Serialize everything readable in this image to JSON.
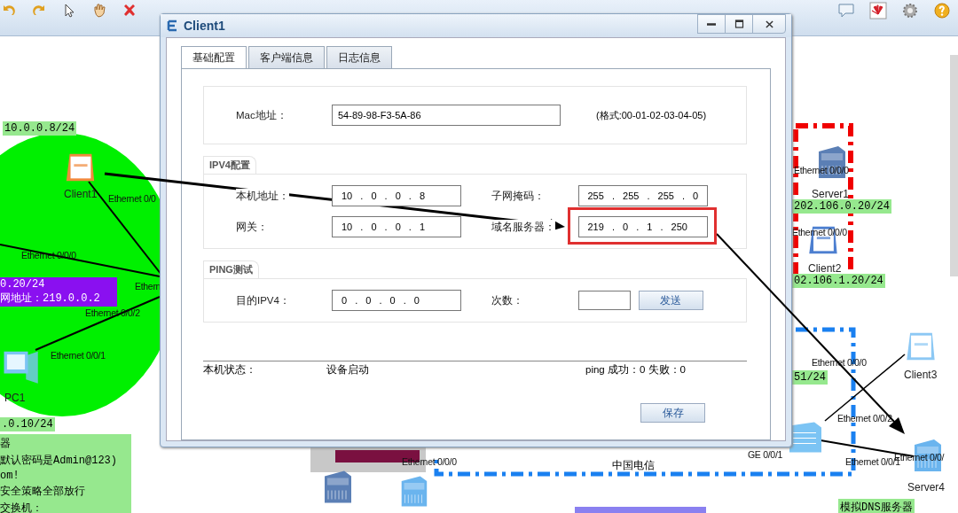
{
  "topology": {
    "devices": [
      {
        "kind": "client",
        "name": "Client1",
        "color": "#f08a3c"
      },
      {
        "kind": "pc",
        "name": "PC1",
        "color": "#7cc4f4"
      },
      {
        "kind": "server",
        "name": "Server1",
        "color": "#5b7fb5"
      },
      {
        "kind": "client",
        "name": "Client2",
        "color": "#4d7fd0"
      },
      {
        "kind": "client",
        "name": "Client3",
        "color": "#8cc8f4"
      },
      {
        "kind": "switch",
        "color": "#7cc4f4"
      },
      {
        "kind": "server",
        "name": "Server4",
        "color": "#6ab4ee"
      },
      {
        "kind": "server",
        "color": "#5b7fb5"
      },
      {
        "kind": "server",
        "color": "#6ab4ee"
      }
    ],
    "port_labels": [
      "Ethernet 0/0",
      "Ethernet 0/0/0",
      "Ethernet 0/0/2",
      "Ethern",
      "Ethernet 0/0/1",
      "Ethernet 0/0/0",
      "Ethernet 0/0/0",
      "Ethernet 0/0/0",
      "Ethernet 0/0/2",
      "GE 0/0/1",
      "Ethernet 0/0/1",
      "Ethernet 0/0/",
      "Ethernet 0/0/0"
    ],
    "address_labels": [
      "10.0.0.8/24",
      ".0.10/24",
      "202.106.0.20/24",
      "02.106.1.20/24",
      "51/24",
      "模拟DNS服务器"
    ],
    "nat_note": [
      "0.20/24",
      "网地址：219.0.0.2"
    ],
    "notes": [
      "器",
      "默认密码是Admin@123)",
      "om!",
      "安全策略全部放行",
      "交换机："
    ],
    "zone_label": "中国电信"
  },
  "dialog": {
    "title": "Client1",
    "tabs": [
      {
        "label": "基础配置",
        "selected": true
      },
      {
        "label": "客户端信息",
        "selected": false
      },
      {
        "label": "日志信息",
        "selected": false
      }
    ],
    "mac": {
      "label": "Mac地址：",
      "value": "54-89-98-F3-5A-86",
      "hint": "(格式:00-01-02-03-04-05)"
    },
    "ipv4": {
      "title": "IPV4配置",
      "fields": [
        {
          "label": "本机地址：",
          "value": "10 . 0 . 0 . 8"
        },
        {
          "label": "子网掩码：",
          "value": "255 . 255 . 255 . 0"
        },
        {
          "label": "网关：",
          "value": "10 . 0 . 0 . 1"
        },
        {
          "label": "域名服务器：",
          "value": "219 . 0 . 1 . 250",
          "highlighted": true
        }
      ]
    },
    "ping": {
      "title": "PING测试",
      "target_label": "目的IPV4：",
      "target_value": "0 . 0 . 0 . 0",
      "count_label": "次数：",
      "send_button": "发送"
    },
    "status": {
      "label": "本机状态：",
      "value": "设备启动",
      "result": "ping 成功：0 失败：0"
    },
    "save_button": "保存"
  }
}
